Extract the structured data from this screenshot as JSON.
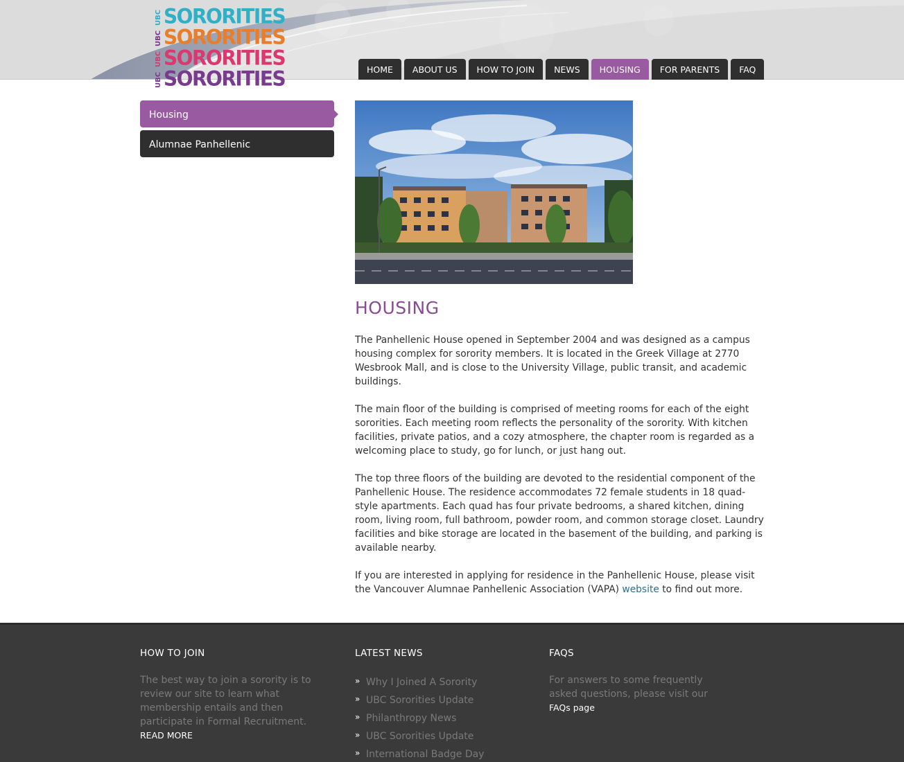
{
  "logo": {
    "ubc": "UBC",
    "word": "SORORITIES",
    "colors": [
      "#2fb0c6",
      "#ea7d2a",
      "#d9396f",
      "#7a3a8e"
    ]
  },
  "nav": {
    "items": [
      {
        "label": "HOME"
      },
      {
        "label": "ABOUT US"
      },
      {
        "label": "HOW TO JOIN"
      },
      {
        "label": "NEWS"
      },
      {
        "label": "HOUSING"
      },
      {
        "label": "FOR PARENTS"
      },
      {
        "label": "FAQ"
      }
    ],
    "active": "HOUSING"
  },
  "sidebar": {
    "items": [
      {
        "label": "Housing"
      },
      {
        "label": "Alumnae Panhellenic"
      }
    ]
  },
  "main": {
    "title": "HOUSING",
    "p1": "The Panhellenic House opened in September 2004 and was designed as a campus housing complex for sorority members. It is located in the Greek Village at 2770 Wesbrook Mall, and is close to the University Village, public transit, and academic buildings.",
    "p2": "The main floor of the building is comprised of meeting rooms for each of the eight sororities. Each meeting room reflects the personality of the sorority. With kitchen facilities, private patios, and a cozy atmosphere, the chapter room is regarded as a welcoming place to study, go for lunch, or just hang out.",
    "p3": "The top three floors of the building are devoted to the residential component of the Panhellenic House. The residence accommodates 72 female students in 18 quad-style apartments. Each quad has four private bedrooms, a shared kitchen, dining room, living room, full bathroom, powder room, and common storage closet. Laundry facilities and bike storage are located in the basement of the building, and parking is available nearby.",
    "p4_before": "If you are interested in applying for residence in the Panhellenic House, please visit the Vancouver Alumnae Panhellenic Association (VAPA) ",
    "p4_link": "website",
    "p4_after": " to find out more."
  },
  "footer": {
    "join": {
      "heading": "HOW TO JOIN",
      "text": "The best way to join a sorority is to review our site to learn what membership entails and then participate in Formal Recruitment.",
      "more": "READ MORE"
    },
    "news": {
      "heading": "LATEST NEWS",
      "items": [
        "Why I Joined A Sorority",
        "UBC Sororities Update",
        "Philanthropy News",
        "UBC Sororities Update",
        "International Badge Day"
      ],
      "bullet": "»"
    },
    "faqs": {
      "heading": "FAQS",
      "text": "For answers to some frequently asked questions, please visit our ",
      "link": "FAQs page"
    }
  }
}
